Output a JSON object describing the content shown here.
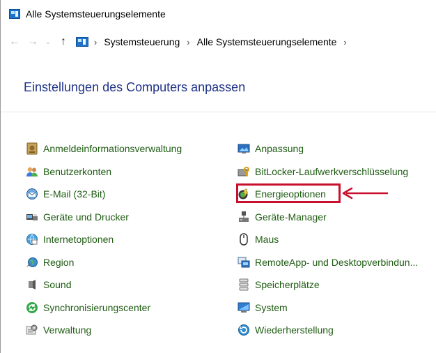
{
  "window": {
    "title": "Alle Systemsteuerungselemente"
  },
  "navigation": {
    "back": "←",
    "forward": "→",
    "recent": "⌄",
    "up": "↑",
    "breadcrumbs": [
      "Systemsteuerung",
      "Alle Systemsteuerungselemente"
    ],
    "separator": "›"
  },
  "main": {
    "heading": "Einstellungen des Computers anpassen",
    "left_items": [
      {
        "label": "Anmeldeinformationsverwaltung",
        "icon": "credential-manager-icon"
      },
      {
        "label": "Benutzerkonten",
        "icon": "user-accounts-icon"
      },
      {
        "label": "E-Mail (32-Bit)",
        "icon": "mail-icon"
      },
      {
        "label": "Geräte und Drucker",
        "icon": "devices-printers-icon"
      },
      {
        "label": "Internetoptionen",
        "icon": "internet-options-icon"
      },
      {
        "label": "Region",
        "icon": "region-icon"
      },
      {
        "label": "Sound",
        "icon": "sound-icon"
      },
      {
        "label": "Synchronisierungscenter",
        "icon": "sync-center-icon"
      },
      {
        "label": "Verwaltung",
        "icon": "administrative-tools-icon"
      }
    ],
    "right_items": [
      {
        "label": "Anpassung",
        "icon": "personalization-icon"
      },
      {
        "label": "BitLocker-Laufwerkverschlüsselung",
        "icon": "bitlocker-icon"
      },
      {
        "label": "Energieoptionen",
        "icon": "power-options-icon"
      },
      {
        "label": "Geräte-Manager",
        "icon": "device-manager-icon"
      },
      {
        "label": "Maus",
        "icon": "mouse-icon"
      },
      {
        "label": "RemoteApp- und Desktopverbindun...",
        "icon": "remoteapp-icon"
      },
      {
        "label": "Speicherplätze",
        "icon": "storage-spaces-icon"
      },
      {
        "label": "System",
        "icon": "system-icon"
      },
      {
        "label": "Wiederherstellung",
        "icon": "recovery-icon"
      }
    ]
  },
  "colors": {
    "link": "#1d5b11",
    "heading": "#1e3287",
    "highlight": "#c8102e"
  }
}
